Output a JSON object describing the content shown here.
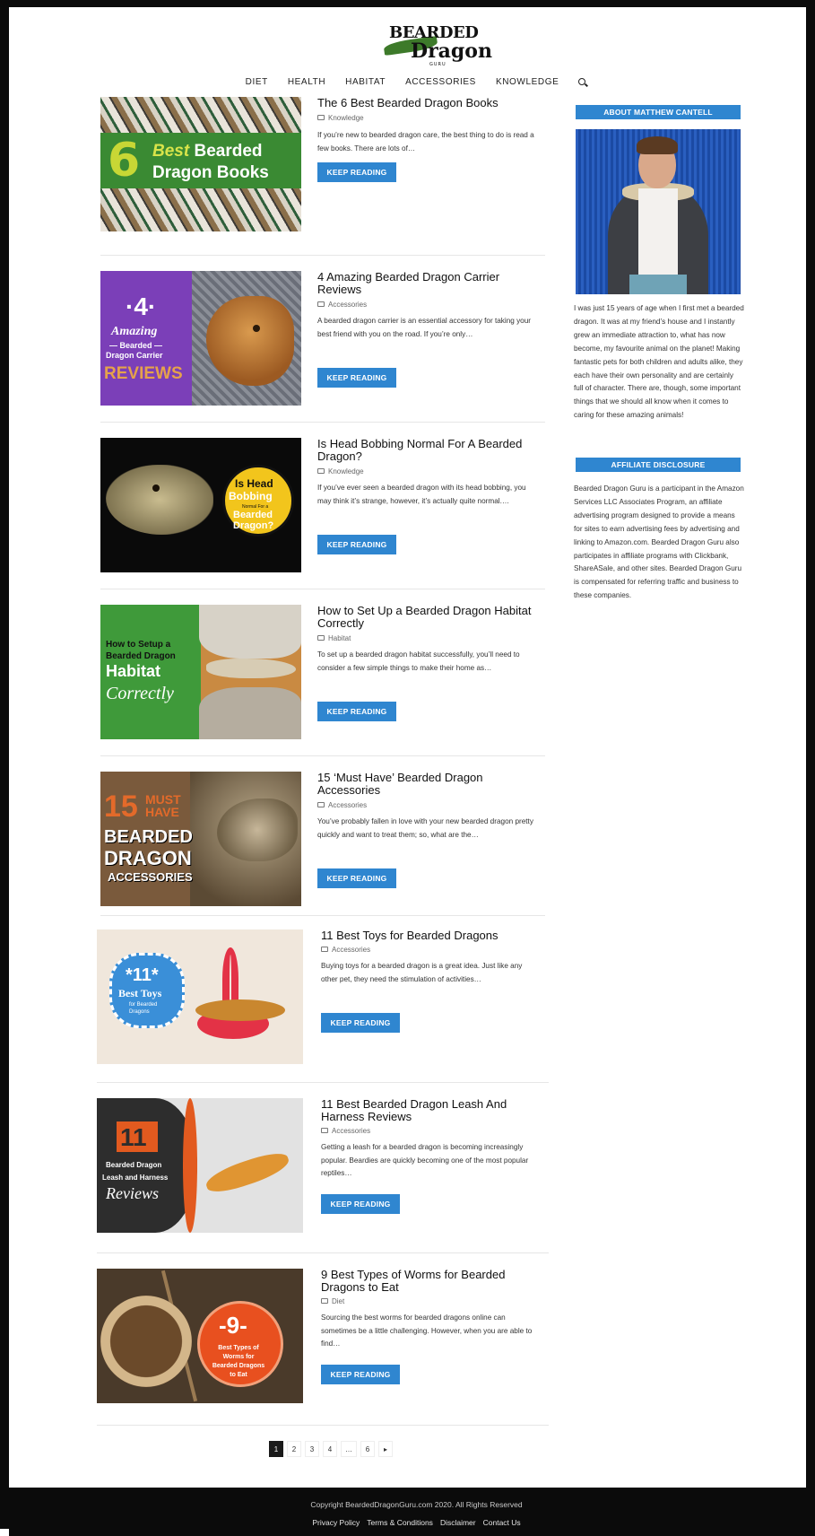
{
  "logo": {
    "line1": "BEARDED",
    "line2": "Dragon",
    "line3": "GURU"
  },
  "nav": {
    "items": [
      "DIET",
      "HEALTH",
      "HABITAT",
      "ACCESSORIES",
      "KNOWLEDGE"
    ],
    "search_icon": "search-icon"
  },
  "posts": [
    {
      "title": "The 6 Best Bearded Dragon Books",
      "category": "Knowledge",
      "excerpt": "If you’re new to bearded dragon care, the best thing to do is read a few books. There are lots of…",
      "button": "KEEP READING",
      "image_text": [
        "6",
        "Best",
        "Bearded",
        "Dragon Books"
      ]
    },
    {
      "title": "4 Amazing Bearded Dragon Carrier Reviews",
      "category": "Accessories",
      "excerpt": "A bearded dragon carrier is an essential accessory for taking your best friend with you on the road. If you’re only…",
      "button": "KEEP READING",
      "image_text": [
        "·4·",
        "Amazing",
        "— Bearded —",
        "Dragon Carrier",
        "REVIEWS"
      ]
    },
    {
      "title": "Is Head Bobbing Normal For A Bearded Dragon?",
      "category": "Knowledge",
      "excerpt": "If you’ve ever seen a bearded dragon with its head bobbing, you may think it’s strange, however, it’s actually quite normal.…",
      "button": "KEEP READING",
      "image_text": [
        "Is Head",
        "Bobbing",
        "Normal For a",
        "Bearded Dragon?"
      ]
    },
    {
      "title": "How to Set Up a Bearded Dragon Habitat Correctly",
      "category": "Habitat",
      "excerpt": "To set up a bearded dragon habitat successfully, you’ll need to consider a few simple things to make their home as…",
      "button": "KEEP READING",
      "image_text": [
        "How to Setup a Bearded Dragon",
        "Habitat",
        "Correctly"
      ]
    },
    {
      "title": "15 ‘Must Have’ Bearded Dragon Accessories",
      "category": "Accessories",
      "excerpt": "You’ve probably fallen in love with your new bearded dragon pretty quickly and want to treat them; so, what are the…",
      "button": "KEEP READING",
      "image_text": [
        "15",
        "MUST HAVE",
        "BEARDED",
        "DRAGON",
        "ACCESSORIES"
      ]
    },
    {
      "title": "11 Best Toys for Bearded Dragons",
      "category": "Accessories",
      "excerpt": "Buying toys for a bearded dragon is a great idea. Just like any other pet, they need the stimulation of activities…",
      "button": "KEEP READING",
      "image_text": [
        "*11*",
        "Best Toys",
        "for Bearded Dragons"
      ]
    },
    {
      "title": "11 Best Bearded Dragon Leash And Harness Reviews",
      "category": "Accessories",
      "excerpt": "Getting a leash for a bearded dragon is becoming increasingly popular. Beardies are quickly becoming one of the most popular reptiles…",
      "button": "KEEP READING",
      "image_text": [
        "11",
        "Bearded Dragon",
        "Leash and Harness",
        "Reviews"
      ]
    },
    {
      "title": "9 Best Types of Worms for Bearded Dragons to Eat",
      "category": "Diet",
      "excerpt": "Sourcing the best worms for bearded dragons online can sometimes be a little challenging. However, when you are able to find…",
      "button": "KEEP READING",
      "image_text": [
        "-9-",
        "Best Types of Worms for Bearded Dragons to Eat"
      ]
    }
  ],
  "sidebar": {
    "about_heading": "ABOUT MATTHEW CANTELL",
    "about_text": "I was just 15 years of age when I first met a bearded dragon. It was at my friend’s house and I instantly grew an immediate attraction to, what has now become, my favourite animal on the planet! Making fantastic pets for both children and adults alike, they each have their own personality and are certainly full of character. There are, though, some important things that we should all know when it comes to caring for these amazing animals!",
    "disclosure_heading": "AFFILIATE DISCLOSURE",
    "disclosure_text": "Bearded Dragon Guru is a participant in the Amazon Services LLC Associates Program, an affiliate advertising program designed to provide a means for sites to earn advertising fees by advertising and linking to Amazon.com. Bearded Dragon Guru also participates in affiliate programs with Clickbank, ShareASale, and other sites. Bearded Dragon Guru is compensated for referring traffic and business to these companies."
  },
  "pagination": [
    "1",
    "2",
    "3",
    "4",
    "…",
    "6",
    "▸"
  ],
  "footer": {
    "copyright": "Copyright BeardedDragonGuru.com 2020. All Rights Reserved",
    "links": [
      "Privacy Policy",
      "Terms & Conditions",
      "Disclaimer",
      "Contact Us"
    ]
  }
}
